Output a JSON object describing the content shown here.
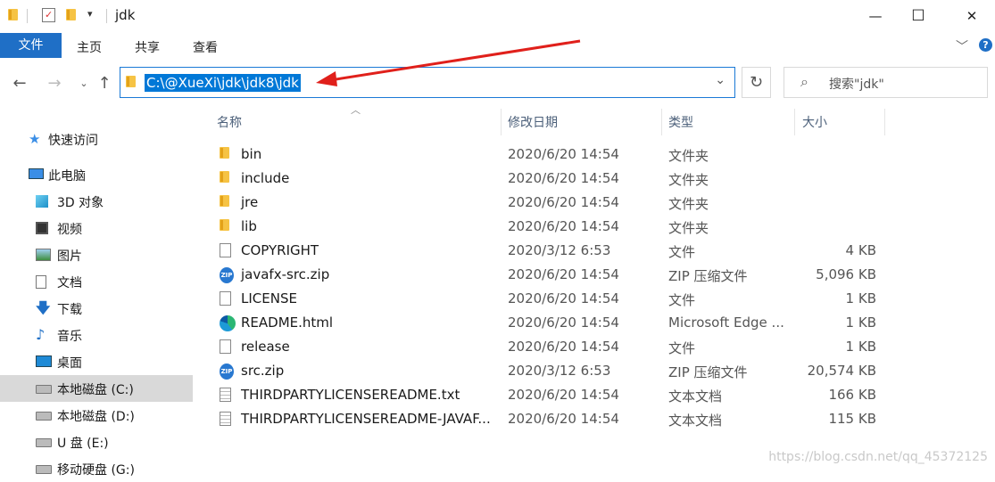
{
  "window": {
    "title": "jdk",
    "controls": {
      "minimize": "—",
      "maximize": "☐",
      "close": "✕"
    }
  },
  "ribbon": {
    "tabs": [
      "文件",
      "主页",
      "共享",
      "查看"
    ]
  },
  "navigation": {
    "address": "C:\\@XueXi\\jdk\\jdk8\\jdk",
    "search_placeholder": "搜索\"jdk\""
  },
  "sidebar": {
    "items": [
      {
        "label": "快速访问",
        "icon": "star-icon"
      },
      {
        "label": "此电脑",
        "icon": "computer-icon"
      },
      {
        "label": "3D 对象",
        "icon": "cube-icon"
      },
      {
        "label": "视频",
        "icon": "video-icon"
      },
      {
        "label": "图片",
        "icon": "picture-icon"
      },
      {
        "label": "文档",
        "icon": "document-icon"
      },
      {
        "label": "下载",
        "icon": "download-icon"
      },
      {
        "label": "音乐",
        "icon": "music-icon"
      },
      {
        "label": "桌面",
        "icon": "desktop-icon"
      },
      {
        "label": "本地磁盘 (C:)",
        "icon": "drive-icon",
        "selected": true
      },
      {
        "label": "本地磁盘 (D:)",
        "icon": "drive-icon"
      },
      {
        "label": "U 盘 (E:)",
        "icon": "drive-icon"
      },
      {
        "label": "移动硬盘 (G:)",
        "icon": "drive-icon"
      }
    ]
  },
  "columns": {
    "name": "名称",
    "modified": "修改日期",
    "type": "类型",
    "size": "大小"
  },
  "files": [
    {
      "name": "bin",
      "modified": "2020/6/20 14:54",
      "type": "文件夹",
      "size": "",
      "icon": "folder-icon"
    },
    {
      "name": "include",
      "modified": "2020/6/20 14:54",
      "type": "文件夹",
      "size": "",
      "icon": "folder-icon"
    },
    {
      "name": "jre",
      "modified": "2020/6/20 14:54",
      "type": "文件夹",
      "size": "",
      "icon": "folder-icon"
    },
    {
      "name": "lib",
      "modified": "2020/6/20 14:54",
      "type": "文件夹",
      "size": "",
      "icon": "folder-icon"
    },
    {
      "name": "COPYRIGHT",
      "modified": "2020/3/12 6:53",
      "type": "文件",
      "size": "4 KB",
      "icon": "file-icon"
    },
    {
      "name": "javafx-src.zip",
      "modified": "2020/6/20 14:54",
      "type": "ZIP 压缩文件",
      "size": "5,096 KB",
      "icon": "zip-icon"
    },
    {
      "name": "LICENSE",
      "modified": "2020/6/20 14:54",
      "type": "文件",
      "size": "1 KB",
      "icon": "file-icon"
    },
    {
      "name": "README.html",
      "modified": "2020/6/20 14:54",
      "type": "Microsoft Edge ...",
      "size": "1 KB",
      "icon": "edge-icon"
    },
    {
      "name": "release",
      "modified": "2020/6/20 14:54",
      "type": "文件",
      "size": "1 KB",
      "icon": "file-icon"
    },
    {
      "name": "src.zip",
      "modified": "2020/3/12 6:53",
      "type": "ZIP 压缩文件",
      "size": "20,574 KB",
      "icon": "zip-icon"
    },
    {
      "name": "THIRDPARTYLICENSEREADME.txt",
      "modified": "2020/6/20 14:54",
      "type": "文本文档",
      "size": "166 KB",
      "icon": "text-icon"
    },
    {
      "name": "THIRDPARTYLICENSEREADME-JAVAF...",
      "modified": "2020/6/20 14:54",
      "type": "文本文档",
      "size": "115 KB",
      "icon": "text-icon"
    }
  ],
  "watermark": "https://blog.csdn.net/qq_45372125",
  "colors": {
    "accent": "#0078d7",
    "file_tab": "#1f6fc6",
    "arrow": "#e0201b",
    "folder": "#f6c344"
  }
}
